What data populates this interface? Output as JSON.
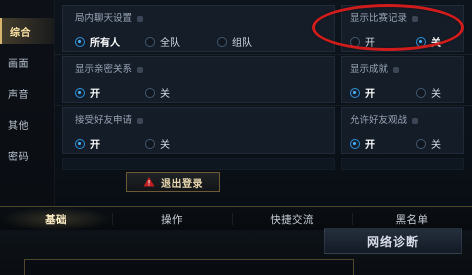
{
  "sidebar": {
    "items": [
      {
        "label": "综合",
        "active": true
      },
      {
        "label": "画面"
      },
      {
        "label": "声音"
      },
      {
        "label": "其他"
      },
      {
        "label": "密码"
      }
    ]
  },
  "settings": {
    "chat": {
      "title": "局内聊天设置",
      "options": [
        "所有人",
        "全队",
        "组队"
      ],
      "selected": "所有人"
    },
    "show_match_record": {
      "title": "显示比赛记录",
      "options": [
        "开",
        "关"
      ],
      "selected": "关"
    },
    "show_relationship": {
      "title": "显示亲密关系",
      "options": [
        "开",
        "关"
      ],
      "selected": "开"
    },
    "show_achievements": {
      "title": "显示成就",
      "options": [
        "开",
        "关"
      ],
      "selected": "开"
    },
    "accept_friend_requests": {
      "title": "接受好友申请",
      "options": [
        "开",
        "关"
      ],
      "selected": "开"
    },
    "allow_friend_spectate": {
      "title": "允许好友观战",
      "options": [
        "开",
        "关"
      ],
      "selected": "开"
    }
  },
  "buttons": {
    "logout": "退出登录",
    "network_diagnose": "网络诊断"
  },
  "tabs": [
    "基础",
    "操作",
    "快捷交流",
    "黑名单"
  ],
  "colors": {
    "accent": "#d7b56f",
    "radio_selected": "#4eb2ff",
    "annotation_red": "#d11c1c"
  },
  "icons": {
    "warning": "warning-icon",
    "info": "info-icon"
  }
}
